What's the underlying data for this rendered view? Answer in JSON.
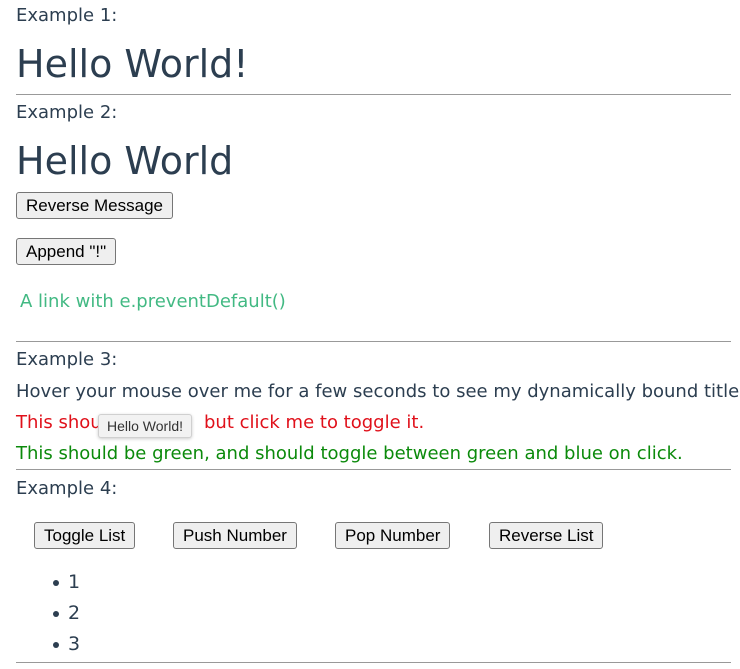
{
  "example1": {
    "label": "Example 1:",
    "message": "Hello World!"
  },
  "example2": {
    "label": "Example 2:",
    "message": "Hello World",
    "reverse_button": "Reverse Message",
    "append_button": "Append \"!\"",
    "link_text": "A link with e.preventDefault()"
  },
  "example3": {
    "label": "Example 3:",
    "hover_text": "Hover your mouse over me for a few seconds to see my dynamically bound title!",
    "red_text_start": "This shou",
    "red_text_end": "but click me to toggle it.",
    "tooltip_text": "Hello World!",
    "green_text": "This should be green, and should toggle between green and blue on click."
  },
  "example4": {
    "label": "Example 4:",
    "buttons": [
      "Toggle List",
      "Push Number",
      "Pop Number",
      "Reverse List"
    ],
    "items": [
      "1",
      "2",
      "3"
    ]
  },
  "colors": {
    "text": "#2c3e50",
    "link": "#42b983",
    "red": "#e0101a",
    "green": "#0b8a0b",
    "divider": "#999999"
  }
}
